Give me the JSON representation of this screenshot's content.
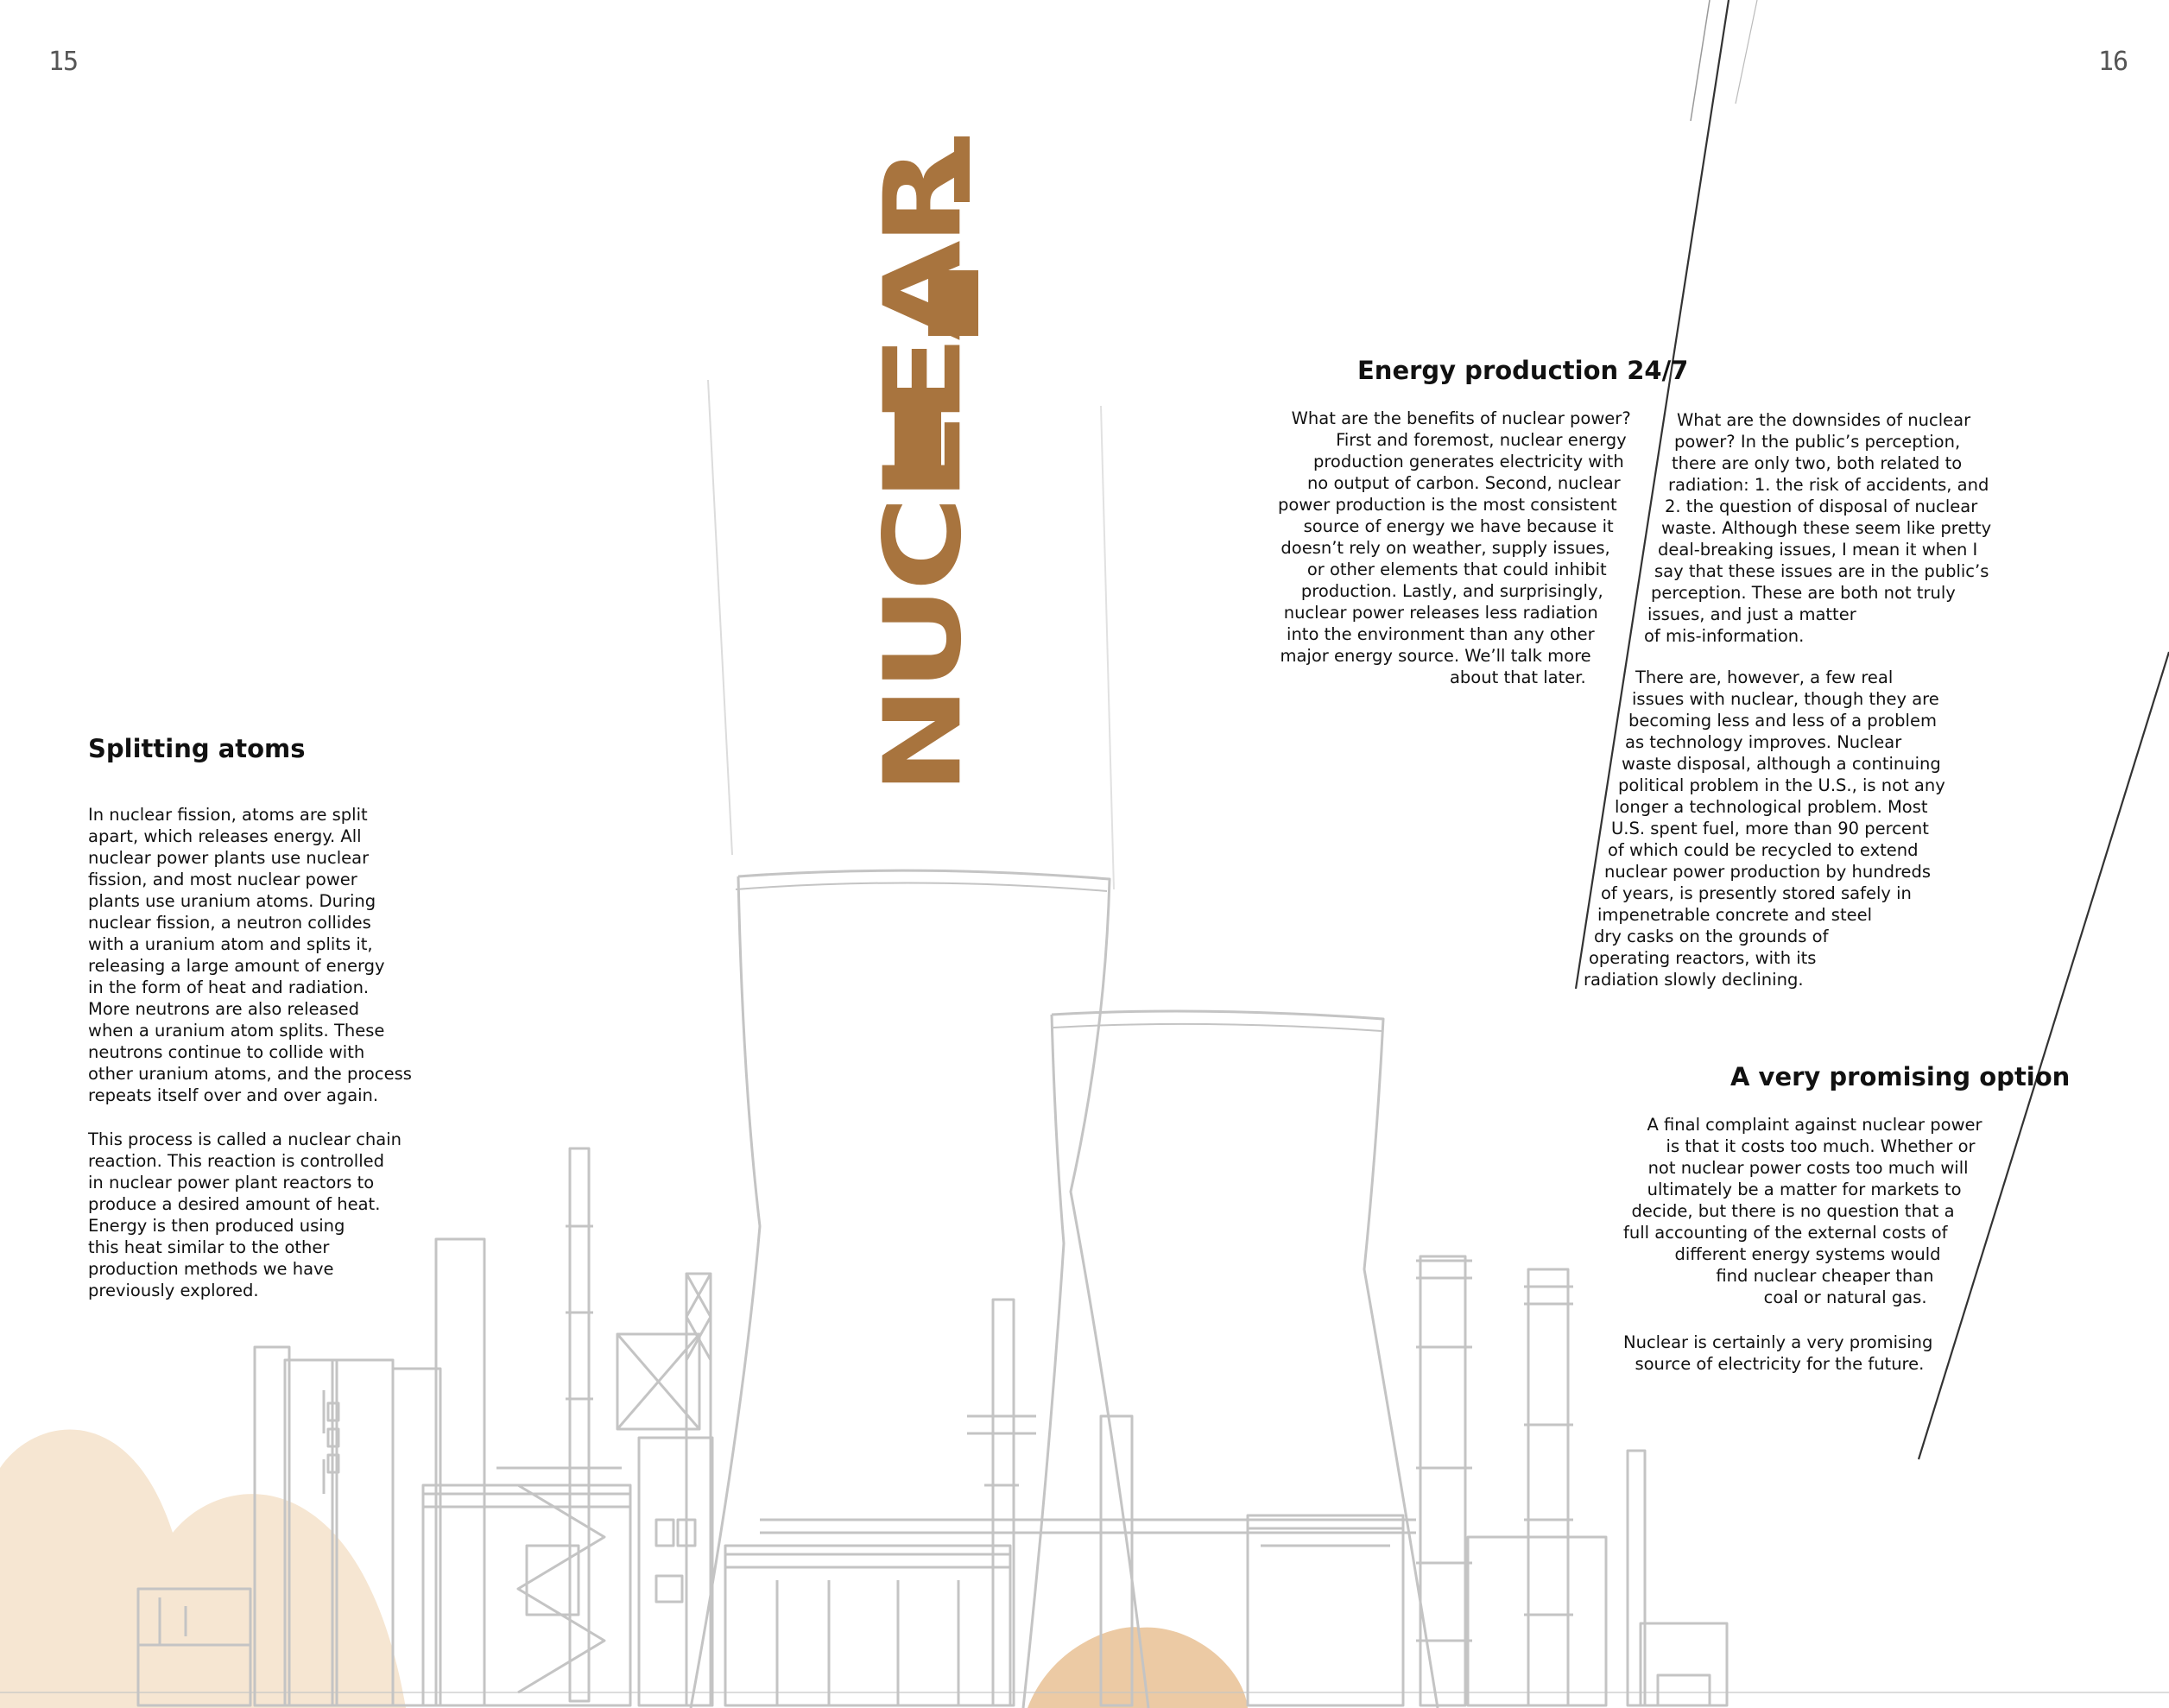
{
  "page_numbers": {
    "left": "15",
    "right": "16"
  },
  "title_word": "NUCLEAR",
  "colors": {
    "accent": "#a8743e",
    "sketch": "#c4c4c4",
    "peach": "#f6e6d2",
    "text": "#111111"
  },
  "left_column": {
    "heading": "Splitting atoms",
    "para1": [
      "In nuclear fission, atoms are split",
      "apart, which releases energy. All",
      "nuclear power plants use nuclear",
      "fission, and most nuclear power",
      "plants use uranium atoms. During",
      "nuclear fission, a neutron collides",
      "with a uranium atom and splits it,",
      "releasing a large amount of energy",
      "in the form of heat and radiation.",
      "More neutrons are also released",
      "when a uranium atom splits. These",
      "neutrons continue to collide with",
      "other uranium atoms, and the process",
      "repeats itself over and over again."
    ],
    "para2": [
      "This process is called a nuclear chain",
      "reaction. This reaction is controlled",
      "in nuclear power plant reactors to",
      "produce a desired amount of heat.",
      "Energy is then produced using",
      "this heat similar to the other",
      "production methods we have",
      "previously explored."
    ]
  },
  "energy": {
    "heading": "Energy production 24/7",
    "benefits": [
      "What are the benefits of nuclear power?",
      "First and foremost, nuclear energy",
      "production generates electricity with",
      "no output of carbon. Second, nuclear",
      "power production is the most consistent",
      "source of energy we have because it",
      "doesn’t rely on weather, supply issues,",
      "or other elements that could inhibit",
      "production. Lastly, and surprisingly,",
      "nuclear power releases less radiation",
      "into the environment than any other",
      "major energy source. We’ll talk more",
      "about that later."
    ],
    "downsides": [
      "What are the downsides of nuclear",
      "power? In the public’s perception,",
      "there are only two, both related to",
      "radiation: 1. the risk of accidents, and",
      "2. the question of disposal of nuclear",
      "waste. Although these seem like pretty",
      "deal-breaking issues, I mean it when I",
      "say that these issues are in the public’s",
      "perception. These are both not truly",
      "issues, and just a matter",
      "of mis-information."
    ],
    "real_issues": [
      "There are, however, a few real",
      "issues with nuclear, though they are",
      "becoming less and less of a problem",
      "as technology improves. Nuclear",
      "waste disposal, although a continuing",
      "political problem in the U.S., is not any",
      "longer a technological problem. Most",
      "U.S. spent fuel, more than 90 percent",
      "of which could be recycled to extend",
      "nuclear power production by hundreds",
      "of years, is presently stored safely in",
      "impenetrable concrete and steel",
      "dry casks on the grounds of",
      "operating reactors, with its",
      "radiation slowly declining."
    ]
  },
  "promising": {
    "heading": "A very promising option",
    "para1": [
      "A final complaint against nuclear power",
      "is that it costs too much. Whether or",
      "not nuclear power costs too much will",
      "ultimately be a matter for markets to",
      "decide, but there is no question that a",
      "full accounting of the external costs of",
      "different energy systems would",
      "find nuclear cheaper than",
      "coal or natural gas."
    ],
    "para2": [
      "Nuclear is certainly a very promising",
      "source of electricity for the future."
    ]
  }
}
